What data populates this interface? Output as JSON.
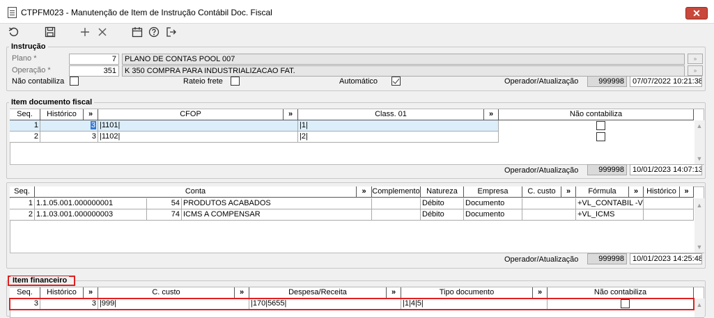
{
  "window": {
    "title": "CTPFM023 - Manutenção de Item de Instrução Contábil Doc. Fiscal",
    "close": "✕"
  },
  "toolbar": {
    "undo_icon": "↺",
    "save_icon": "💾",
    "add_icon": "+",
    "delete_icon": "✕",
    "calendar_icon": "📅",
    "help_icon": "?",
    "exit_icon": "↦"
  },
  "instrucao": {
    "title": "Instrução",
    "plano_label": "Plano *",
    "plano_code": "7",
    "plano_desc": "PLANO DE CONTAS POOL 007",
    "operacao_label": "Operação *",
    "operacao_code": "351",
    "operacao_desc": "K 350 COMPRA PARA INDUSTRIALIZACAO FAT.",
    "nao_contabiliza_label": "Não contabiliza",
    "rateio_frete_label": "Rateio frete",
    "automatico_label": "Automático",
    "operador_label": "Operador/Atualização",
    "operador": "999998",
    "atualizacao": "07/07/2022 10:21:38"
  },
  "item_doc": {
    "title": "Item documento fiscal",
    "columns": [
      "Seq.",
      "Histórico",
      "»",
      "CFOP",
      "»",
      "Class. 01",
      "»",
      "Não contabiliza"
    ],
    "rows": [
      {
        "seq": "1",
        "historico": "3",
        "cfop": "|1101|",
        "class01": "|1|"
      },
      {
        "seq": "2",
        "historico": "3",
        "cfop": "|1102|",
        "class01": "|2|"
      }
    ],
    "operador_label": "Operador/Atualização",
    "operador": "999998",
    "atualizacao": "10/01/2023 14:07:13"
  },
  "contas": {
    "columns": [
      "Seq.",
      "Conta",
      "»",
      "Complemento",
      "Natureza",
      "Empresa",
      "C. custo",
      "»",
      "Fórmula",
      "»",
      "Histórico",
      "»"
    ],
    "rows": [
      {
        "seq": "1",
        "conta": "1.1.05.001.000000001",
        "num": "54",
        "desc": "PRODUTOS ACABADOS",
        "natureza": "Débito",
        "empresa": "Documento",
        "formula": "+VL_CONTABIL -VL"
      },
      {
        "seq": "2",
        "conta": "1.1.03.001.000000003",
        "num": "74",
        "desc": "ICMS A COMPENSAR",
        "natureza": "Débito",
        "empresa": "Documento",
        "formula": "+VL_ICMS"
      }
    ],
    "operador_label": "Operador/Atualização",
    "operador": "999998",
    "atualizacao": "10/01/2023 14:25:48"
  },
  "item_fin": {
    "title": "Item financeiro",
    "columns": [
      "Seq.",
      "Histórico",
      "»",
      "C. custo",
      "»",
      "Despesa/Receita",
      "»",
      "Tipo documento",
      "»",
      "Não contabiliza"
    ],
    "rows": [
      {
        "seq": "3",
        "historico": "3",
        "ccusto": "|999|",
        "despesa": "|170|5655|",
        "tipo": "|1|4|5|"
      }
    ]
  },
  "colors": {
    "highlight": "#e02020",
    "selection": "#dbeefa"
  }
}
